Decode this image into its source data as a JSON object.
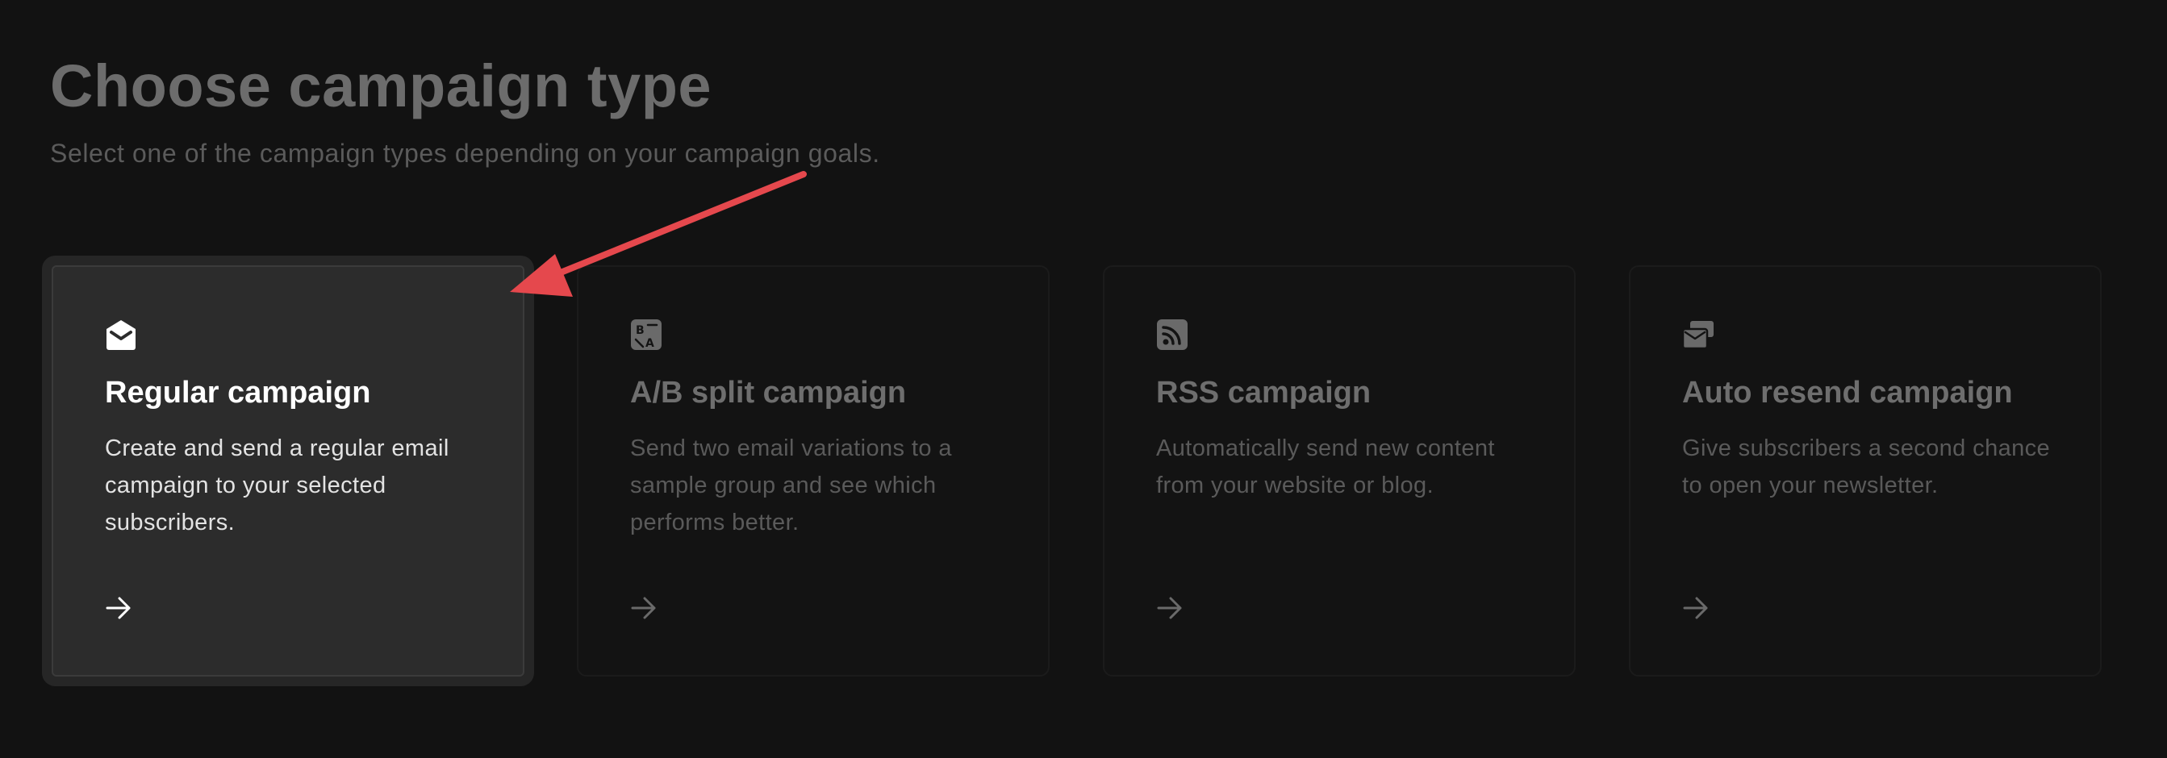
{
  "header": {
    "title": "Choose campaign type",
    "subtitle": "Select one of the campaign types depending on your campaign goals."
  },
  "cards": [
    {
      "icon": "open-envelope-icon",
      "title": "Regular campaign",
      "description": "Create and send a regular email campaign to your selected subscribers.",
      "selected": true
    },
    {
      "icon": "ab-split-icon",
      "title": "A/B split campaign",
      "description": "Send two email variations to a sample group and see which performs better.",
      "selected": false
    },
    {
      "icon": "rss-icon",
      "title": "RSS campaign",
      "description": "Automatically send new content from your website or blog.",
      "selected": false
    },
    {
      "icon": "auto-resend-icon",
      "title": "Auto resend campaign",
      "description": "Give subscribers a second chance to open your newsletter.",
      "selected": false
    }
  ],
  "colors": {
    "background": "#121212",
    "selected_card": "#2c2c2c",
    "annotation_arrow": "#e5484d"
  }
}
